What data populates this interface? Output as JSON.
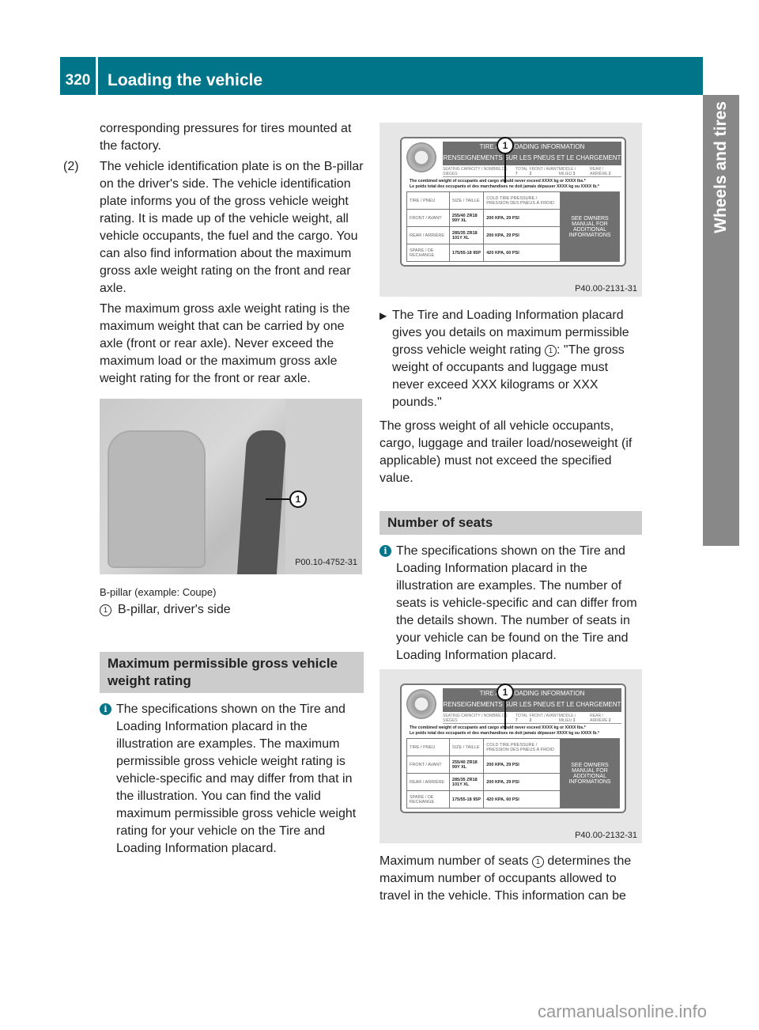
{
  "header": {
    "page_number": "320",
    "title": "Loading the vehicle"
  },
  "sidetab": {
    "label": "Wheels and tires"
  },
  "left_column": {
    "continued_text": "corresponding pressures for tires mounted at the factory.",
    "item2": {
      "number": "(2)",
      "text": "The vehicle identification plate is on the B-pillar on the driver's side. The vehicle identification plate informs you of the gross vehicle weight rating. It is made up of the vehicle weight, all vehicle occupants, the fuel and the cargo. You can also find information about the maximum gross axle weight rating on the front and rear axle.",
      "text2": "The maximum gross axle weight rating is the maximum weight that can be carried by one axle (front or rear axle). Never exceed the maximum load or the maximum gross axle weight rating for the front or rear axle."
    },
    "figure1": {
      "callout": "1",
      "code": "P00.10-4752-31",
      "caption": "B-pillar (example: Coupe)",
      "legend_num": "1",
      "legend_text": "B-pillar, driver's side"
    },
    "section_heading": "Maximum permissible gross vehicle weight rating",
    "info_note": "The specifications shown on the Tire and Loading Information placard in the illustration are examples. The maximum permissible gross vehicle weight rating is vehicle-specific and may differ from that in the illustration. You can find the valid maximum permissible gross vehicle weight rating for your vehicle on the Tire and Loading Information placard."
  },
  "placard": {
    "title_en": "TIRE AND LOADING INFORMATION",
    "title_fr": "RENSEIGNEMENTS SUR LES PNEUS ET LE CHARGEMENT",
    "seating_label": "SEATING CAPACITY / NOMBRE DE SIÈGES",
    "total_label": "TOTAL",
    "total_value": "7",
    "front_label": "FRONT / AVANT",
    "front_value": "2",
    "middle_label": "MIDDLE / MILIEU",
    "middle_value": "3",
    "rear_label": "REAR / ARRIÈRE",
    "rear_value": "2",
    "warning_en": "The combined weight of occupants and cargo should never exceed XXXX kg or XXXX lbs.*",
    "warning_fr": "Le poids total des occupants et des marchandises ne doit jamais dépasser XXXX kg ou XXXX lb.*",
    "columns": [
      "TIRE / PNEU",
      "SIZE / TAILLE",
      "COLD TIRE PRESSURE / PRESSION DES PNEUS À FROID"
    ],
    "rows": [
      {
        "tire": "FRONT / AVANT",
        "size": "255/40 ZR18 99Y XL",
        "pressure": "200 KPA, 29 PSI"
      },
      {
        "tire": "REAR / ARRIÈRE",
        "size": "285/35 ZR18 101Y XL",
        "pressure": "200 KPA, 29 PSI"
      },
      {
        "tire": "SPARE / DE RECHANGE",
        "size": "175/55-18 95P",
        "pressure": "420 KPA, 60 PSI"
      }
    ],
    "see_manual": "SEE OWNERS MANUAL FOR ADDITIONAL INFORMATIONS",
    "callout": "1",
    "code1": "P40.00-2131-31",
    "code2": "P40.00-2132-31"
  },
  "right_column": {
    "step_text": "The Tire and Loading Information placard gives you details on maximum permissible gross vehicle weight rating",
    "step_num": "1",
    "step_quote": ": \"The gross weight of occupants and luggage must never exceed XXX kilograms or XXX pounds.\"",
    "paragraph": "The gross weight of all vehicle occupants, cargo, luggage and trailer load/noseweight (if applicable) must not exceed the specified value.",
    "section_heading": "Number of seats",
    "info_note": "The specifications shown on the Tire and Loading Information placard in the illustration are examples. The number of seats is vehicle-specific and can differ from the details shown. The number of seats in your vehicle can be found on the Tire and Loading Information placard.",
    "final_pre": "Maximum number of seats",
    "final_num": "1",
    "final_post": "determines the maximum number of occupants allowed to travel in the vehicle. This information can be"
  },
  "watermark": "carmanualsonline.info",
  "colors": {
    "accent": "#007489",
    "section_bg": "#cccccc",
    "sidetab": "#888888"
  },
  "icons": {
    "info": "info-icon",
    "step": "triangle-right-icon"
  }
}
